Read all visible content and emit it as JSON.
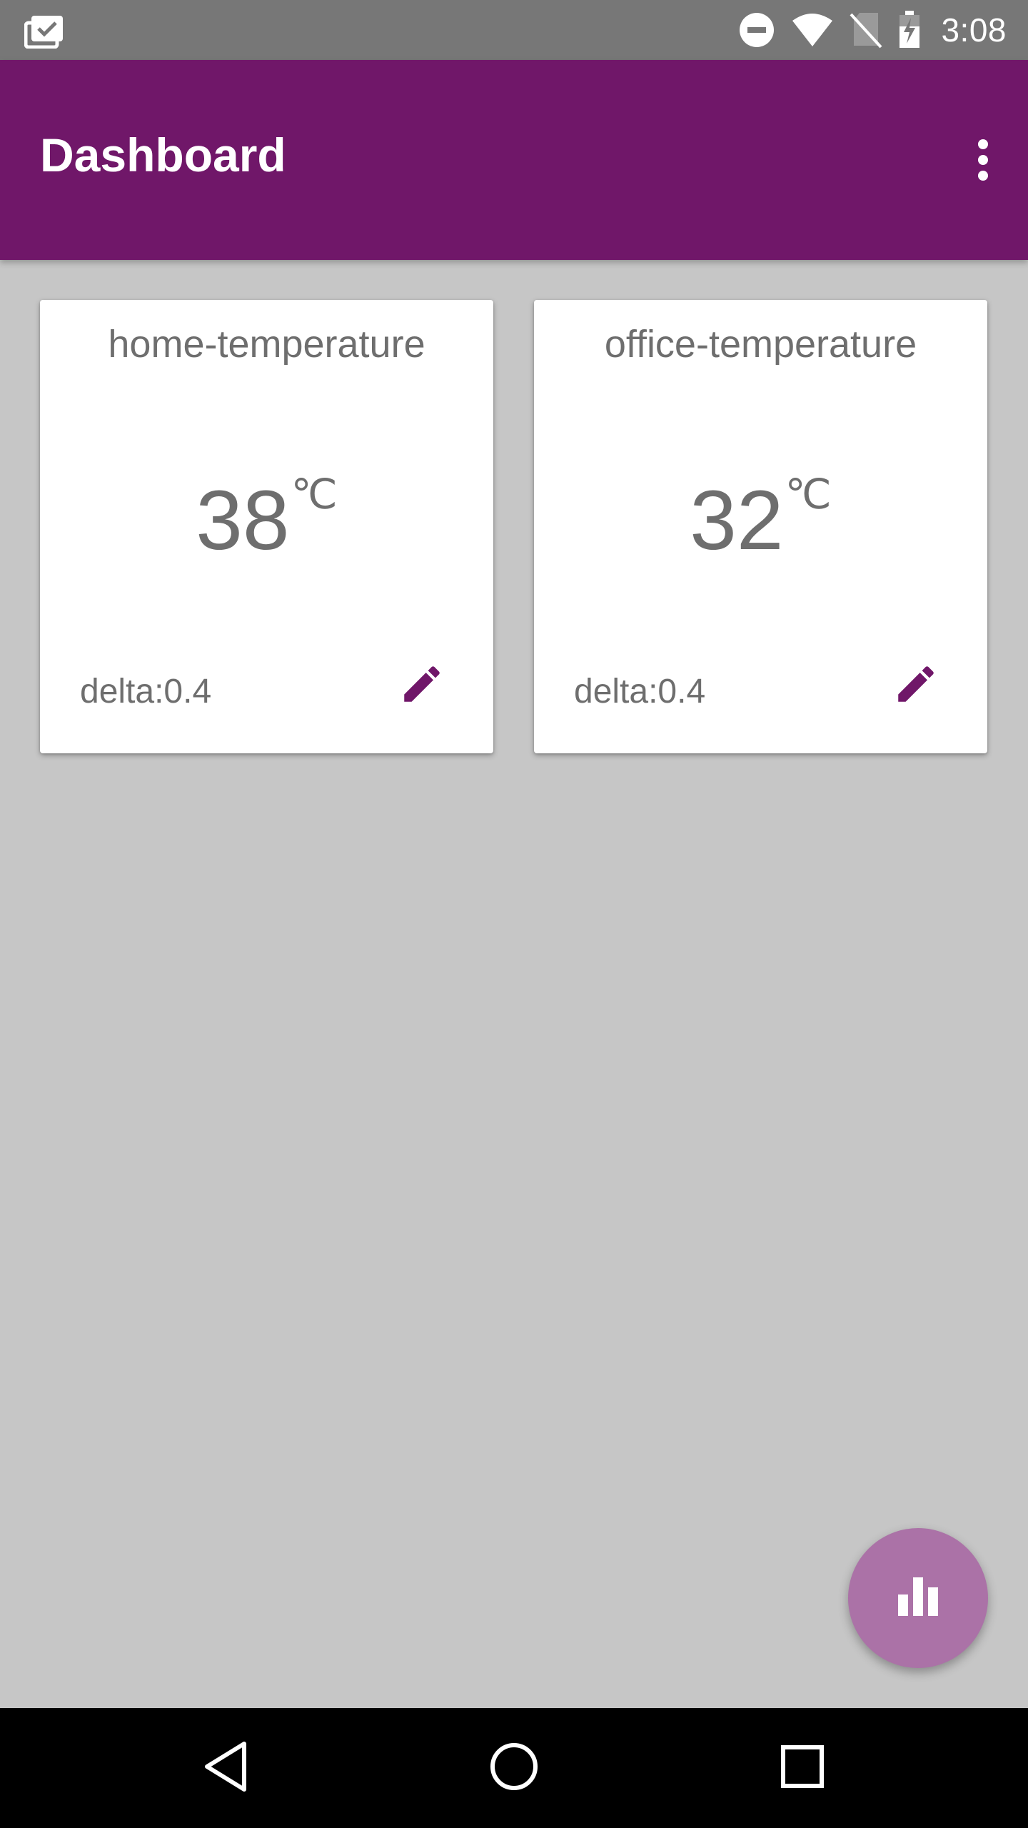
{
  "status_bar": {
    "time": "3:08",
    "icons": [
      "clipboard-check-icon",
      "do-not-disturb-icon",
      "wifi-icon",
      "no-sim-icon",
      "battery-charging-icon"
    ]
  },
  "app_bar": {
    "title": "Dashboard",
    "menu_icon": "more-vert-icon"
  },
  "cards": [
    {
      "title": "home-temperature",
      "value": "38",
      "unit": "℃",
      "delta": "delta:0.4",
      "action_icon": "edit-icon"
    },
    {
      "title": "office-temperature",
      "value": "32",
      "unit": "℃",
      "delta": "delta:0.4",
      "action_icon": "edit-icon"
    }
  ],
  "fab": {
    "icon": "bar-chart-icon"
  },
  "nav_bar": {
    "icons": [
      "back-icon",
      "home-icon",
      "recents-icon"
    ]
  },
  "colors": {
    "primary": "#701769",
    "fab": "#ab72a7",
    "background": "#c6c6c6",
    "status_bar": "#777777",
    "text_secondary": "#6e6e6e"
  }
}
